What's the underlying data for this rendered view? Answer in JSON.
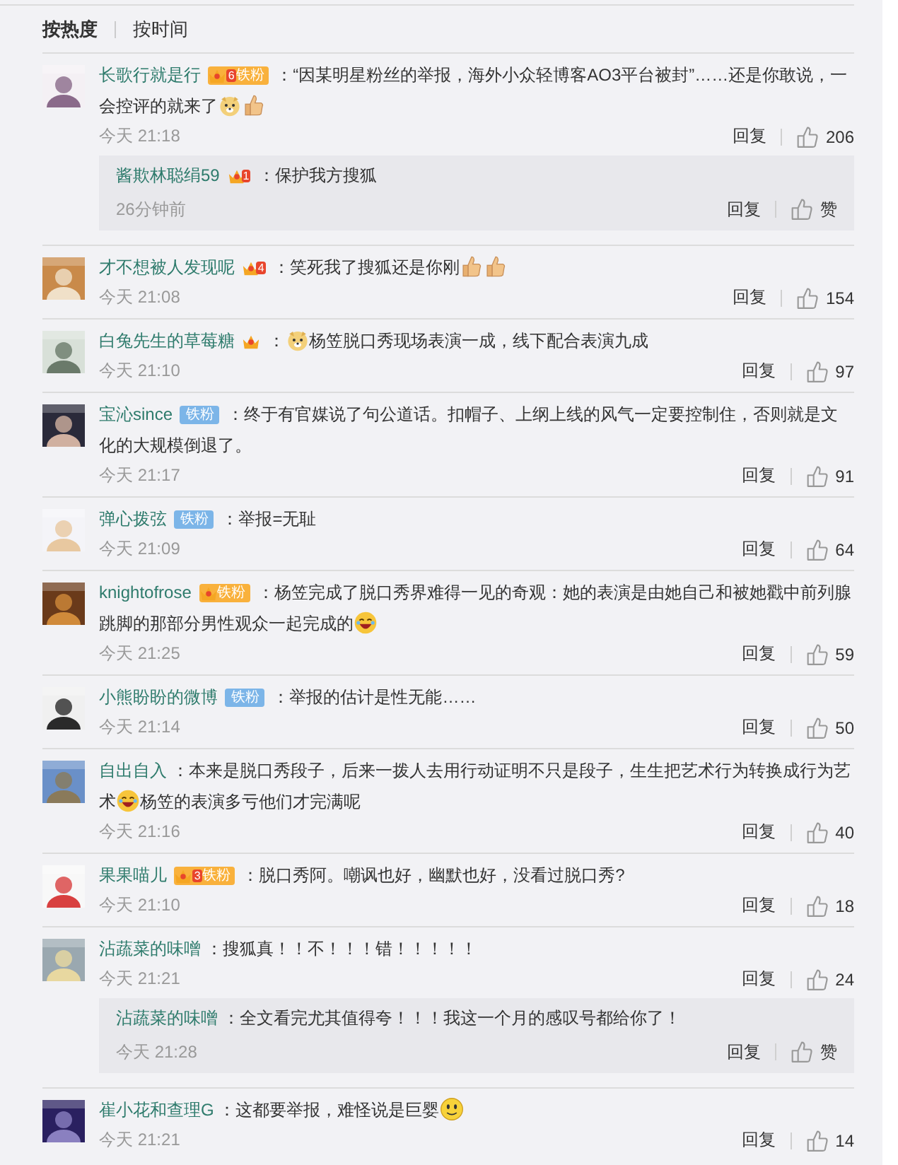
{
  "sort_tabs": [
    {
      "label": "按热度",
      "selected": true
    },
    {
      "label": "按时间",
      "selected": false
    }
  ],
  "comments": [
    {
      "user": "长歌行就是行",
      "badges": [
        {
          "kind": "crown_fan",
          "level": "6",
          "text": "铁粉"
        }
      ],
      "parts": [
        {
          "kind": "text",
          "text": "：“因某明星粉丝的举报，海外小众轻博客AO3平台被封”……还是你敢说，一会控评的就来了"
        },
        {
          "kind": "dog_emoji"
        },
        {
          "kind": "thumb_emoji"
        }
      ],
      "time": "今天 21:18",
      "reply_label": "回复",
      "likes": "206",
      "replies": [
        {
          "user": "酱欺林聪绢59",
          "badges": [
            {
              "kind": "crown",
              "level": "1"
            }
          ],
          "parts": [
            {
              "kind": "text",
              "text": "：保护我方搜狐"
            }
          ],
          "time": "26分钟前",
          "reply_label": "回复",
          "likes": "赞"
        }
      ]
    },
    {
      "user": "才不想被人发现呢",
      "badges": [
        {
          "kind": "crown",
          "level": "4"
        }
      ],
      "parts": [
        {
          "kind": "text",
          "text": "：笑死我了搜狐还是你刚"
        },
        {
          "kind": "thumb_emoji"
        },
        {
          "kind": "thumb_emoji"
        }
      ],
      "time": "今天 21:08",
      "reply_label": "回复",
      "likes": "154"
    },
    {
      "user": "白兔先生的草莓糖",
      "badges": [
        {
          "kind": "crown"
        }
      ],
      "parts": [
        {
          "kind": "text",
          "text": "："
        },
        {
          "kind": "dog_emoji"
        },
        {
          "kind": "text",
          "text": "杨笠脱口秀现场表演一成，线下配合表演九成"
        }
      ],
      "time": "今天 21:10",
      "reply_label": "回复",
      "likes": "97"
    },
    {
      "user": "宝沁since",
      "badges": [
        {
          "kind": "fan",
          "text": "铁粉"
        }
      ],
      "parts": [
        {
          "kind": "text",
          "text": "：终于有官媒说了句公道话。扣帽子、上纲上线的风气一定要控制住，否则就是文化的大规模倒退了。"
        }
      ],
      "time": "今天 21:17",
      "reply_label": "回复",
      "likes": "91"
    },
    {
      "user": "弹心拨弦",
      "badges": [
        {
          "kind": "fan",
          "text": "铁粉"
        }
      ],
      "parts": [
        {
          "kind": "text",
          "text": "：举报=无耻"
        }
      ],
      "time": "今天 21:09",
      "reply_label": "回复",
      "likes": "64"
    },
    {
      "user": "knightofrose",
      "badges": [
        {
          "kind": "crown_fan",
          "text": "铁粉"
        }
      ],
      "parts": [
        {
          "kind": "text",
          "text": "：杨笠完成了脱口秀界难得一见的奇观：她的表演是由她自己和被她戳中前列腺跳脚的那部分男性观众一起完成的"
        },
        {
          "kind": "laugh_emoji"
        }
      ],
      "time": "今天 21:25",
      "reply_label": "回复",
      "likes": "59"
    },
    {
      "user": "小熊盼盼的微博",
      "badges": [
        {
          "kind": "fan",
          "text": "铁粉"
        }
      ],
      "parts": [
        {
          "kind": "text",
          "text": "：举报的估计是性无能……"
        }
      ],
      "time": "今天 21:14",
      "reply_label": "回复",
      "likes": "50"
    },
    {
      "user": "自出自入",
      "parts": [
        {
          "kind": "text",
          "text": "：本来是脱口秀段子，后来一拨人去用行动证明不只是段子，生生把艺术行为转换成行为艺术"
        },
        {
          "kind": "laugh_emoji"
        },
        {
          "kind": "text",
          "text": "杨笠的表演多亏他们才完满呢"
        }
      ],
      "time": "今天 21:16",
      "reply_label": "回复",
      "likes": "40"
    },
    {
      "user": "果果喵儿",
      "badges": [
        {
          "kind": "crown_fan",
          "level": "3",
          "text": "铁粉"
        }
      ],
      "parts": [
        {
          "kind": "text",
          "text": "：脱口秀阿。嘲讽也好，幽默也好，没看过脱口秀?"
        }
      ],
      "time": "今天 21:10",
      "reply_label": "回复",
      "likes": "18"
    },
    {
      "user": "沾蔬菜的味噌",
      "parts": [
        {
          "kind": "text",
          "text": "：搜狐真！！不！！！错！！！！！"
        }
      ],
      "time": "今天 21:21",
      "reply_label": "回复",
      "likes": "24",
      "replies": [
        {
          "user": "沾蔬菜的味噌",
          "parts": [
            {
              "kind": "text",
              "text": "：全文看完尤其值得夸！！！我这一个月的感叹号都给你了！"
            }
          ],
          "time": "今天 21:28",
          "reply_label": "回复",
          "likes": "赞"
        }
      ]
    },
    {
      "user": "崔小花和查理G",
      "parts": [
        {
          "kind": "text",
          "text": "：这都要举报，难怪说是巨婴"
        },
        {
          "kind": "smile_emoji"
        }
      ],
      "time": "今天 21:21",
      "reply_label": "回复",
      "likes": "14"
    }
  ]
}
